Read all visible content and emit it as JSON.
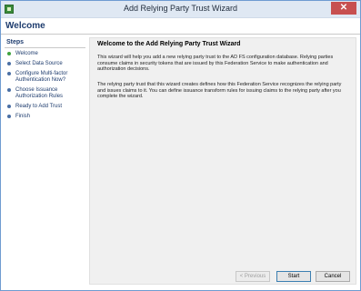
{
  "window": {
    "title": "Add Relying Party Trust Wizard",
    "close_glyph": "✕"
  },
  "header": {
    "title": "Welcome"
  },
  "steps": {
    "label": "Steps",
    "items": [
      {
        "label": "Welcome",
        "current": true
      },
      {
        "label": "Select Data Source",
        "current": false
      },
      {
        "label": "Configure Multi-factor Authentication Now?",
        "current": false
      },
      {
        "label": "Choose Issuance Authorization Rules",
        "current": false
      },
      {
        "label": "Ready to Add Trust",
        "current": false
      },
      {
        "label": "Finish",
        "current": false
      }
    ]
  },
  "main": {
    "title": "Welcome to the Add Relying Party Trust Wizard",
    "paragraph1": "This wizard will help you add a new relying party trust to the AD FS configuration database.  Relying parties consume claims in security tokens that are issued by this Federation Service to make authentication and authorization decisions.",
    "paragraph2": "The relying party trust that this wizard creates defines how this Federation Service recognizes the relying party and issues claims to it. You can define issuance transform rules for issuing claims to the relying party after you complete the wizard."
  },
  "buttons": {
    "previous": "< Previous",
    "start": "Start",
    "cancel": "Cancel"
  },
  "colors": {
    "current_step": "#3fa33f",
    "other_step": "#4a6fa5",
    "close_button": "#c75050"
  }
}
